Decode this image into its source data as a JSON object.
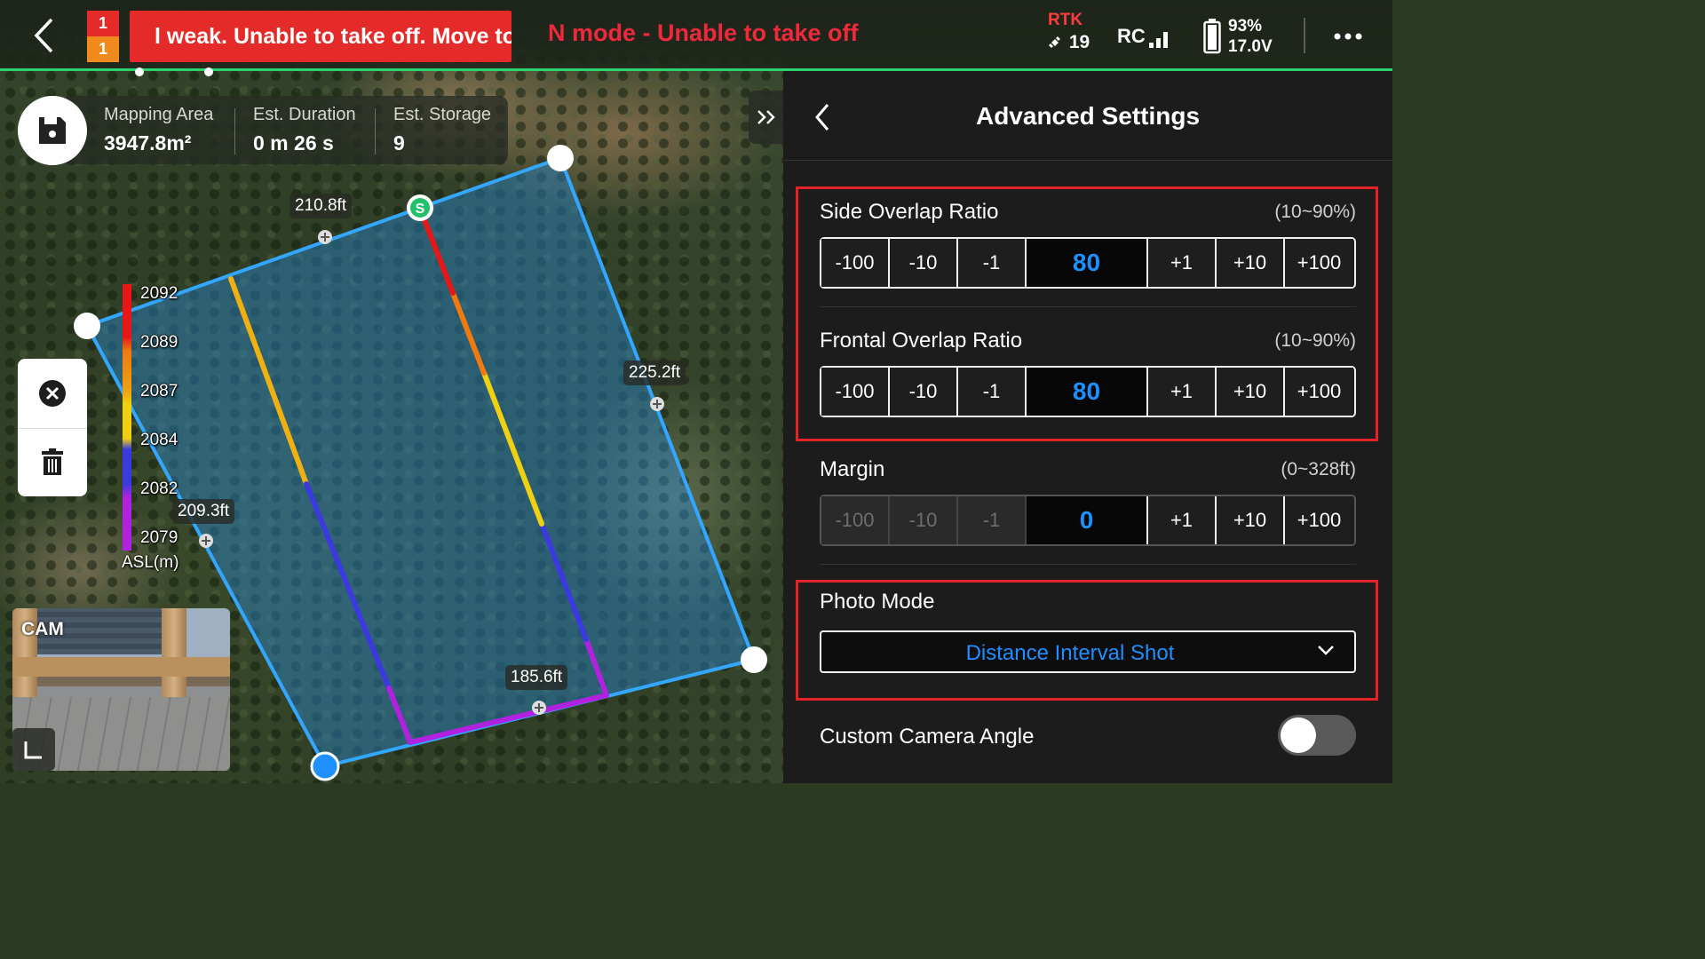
{
  "topbar": {
    "warning_counts": {
      "errors": "1",
      "warnings": "1"
    },
    "banner_text": "l weak. Unable to take off. Move to",
    "mode_warning": "N mode - Unable to take off",
    "rtk_label": "RTK",
    "satellite_count": "19",
    "rc_label": "RC",
    "battery_percent": "93%",
    "battery_voltage": "17.0V"
  },
  "map": {
    "info": [
      {
        "label": "Mapping Area",
        "value": "3947.8m²"
      },
      {
        "label": "Est. Duration",
        "value": "0 m 26 s"
      },
      {
        "label": "Est. Storage",
        "value": "9"
      }
    ],
    "legend": {
      "values": [
        "2092",
        "2089",
        "2087",
        "2084",
        "2082",
        "2079"
      ],
      "unit": "ASL(m)",
      "colors": [
        "#e81616",
        "#f07a10",
        "#f0d010",
        "#3a3ae0",
        "#b021e0"
      ]
    },
    "start_marker": "S",
    "distances": {
      "top_left": "210.8ft",
      "right": "225.2ft",
      "left": "209.3ft",
      "bottom": "185.6ft"
    },
    "camera_label": "CAM",
    "boundary_color": "#33a6ff",
    "route_colors": [
      "#e81616",
      "#f07a10",
      "#f0d010",
      "#3a3ae0",
      "#b021e0"
    ]
  },
  "panel": {
    "title": "Advanced Settings",
    "side_overlap": {
      "label": "Side Overlap Ratio",
      "range": "(10~90%)",
      "value": "80",
      "buttons": [
        "-100",
        "-10",
        "-1",
        "+1",
        "+10",
        "+100"
      ]
    },
    "frontal_overlap": {
      "label": "Frontal Overlap Ratio",
      "range": "(10~90%)",
      "value": "80",
      "buttons": [
        "-100",
        "-10",
        "-1",
        "+1",
        "+10",
        "+100"
      ]
    },
    "margin": {
      "label": "Margin",
      "range": "(0~328ft)",
      "value": "0",
      "buttons": [
        "-100",
        "-10",
        "-1",
        "+1",
        "+10",
        "+100"
      ]
    },
    "photo_mode": {
      "label": "Photo Mode",
      "selected": "Distance Interval Shot"
    },
    "custom_camera_angle": {
      "label": "Custom Camera Angle",
      "enabled": false
    },
    "accent_color": "#1e8fff",
    "highlight_color": "#e32229"
  }
}
